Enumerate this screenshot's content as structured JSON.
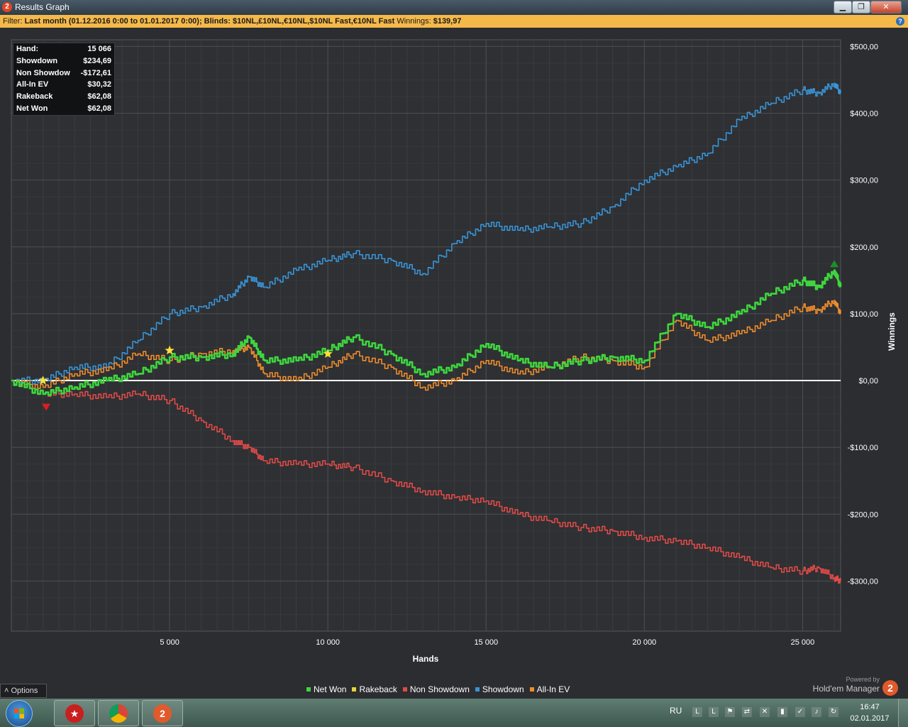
{
  "window": {
    "app_icon": "hm2-logo-icon",
    "title": "Results Graph",
    "controls": [
      "minimize-icon",
      "maximize-icon",
      "close-icon"
    ]
  },
  "filter": {
    "label": "Filter:",
    "text": "Last month (01.12.2016 0:00 to 01.01.2017 0:00); Blinds: $10NL,£10NL,€10NL,$10NL Fast,€10NL Fast",
    "winnings_label": "Winnings:",
    "winnings_value": "$139,97"
  },
  "stats": [
    {
      "label": "Hand:",
      "value": "15 066"
    },
    {
      "label": "Showdown",
      "value": "$234,69"
    },
    {
      "label": "Non Showdown",
      "value": "-$172,61"
    },
    {
      "label": "All-In EV",
      "value": "$30,32"
    },
    {
      "label": "Rakeback",
      "value": "$62,08"
    },
    {
      "label": "Net Won",
      "value": "$62,08"
    }
  ],
  "chart_data": {
    "type": "line",
    "xlabel": "Hands",
    "ylabel": "Winnings",
    "xlim": [
      0,
      26200
    ],
    "ylim": [
      -375,
      510
    ],
    "x_ticks": [
      5000,
      10000,
      15000,
      20000,
      25000
    ],
    "x_tick_labels": [
      "5 000",
      "10 000",
      "15 000",
      "20 000",
      "25 000"
    ],
    "y_ticks": [
      500,
      400,
      300,
      200,
      100,
      0,
      -100,
      -200,
      -300
    ],
    "y_tick_labels": [
      "$500,00",
      "$400,00",
      "$300,00",
      "$200,00",
      "$100,00",
      "$0,00",
      "-$100,00",
      "-$200,00",
      "-$300,00"
    ],
    "grid": true,
    "legend_position": "bottom",
    "x": [
      0,
      1000,
      2000,
      3000,
      4000,
      5000,
      6000,
      7000,
      7500,
      8000,
      9000,
      10000,
      10800,
      12000,
      13000,
      14000,
      15000,
      16000,
      17000,
      18000,
      19000,
      20000,
      21000,
      22000,
      23000,
      24000,
      25000,
      25500,
      26000,
      26200
    ],
    "series": [
      {
        "name": "Net Won",
        "color": "#3ed63e",
        "values": [
          0,
          -20,
          -10,
          0,
          10,
          35,
          35,
          40,
          65,
          30,
          30,
          45,
          65,
          40,
          10,
          20,
          55,
          30,
          20,
          30,
          35,
          30,
          100,
          80,
          100,
          130,
          150,
          140,
          165,
          140
        ]
      },
      {
        "name": "Rakeback",
        "color": "#e6d23c",
        "values": [
          0,
          -5,
          -5,
          -5,
          -5,
          -5,
          -5,
          -5,
          -5,
          -5,
          -5,
          -5,
          -5,
          -5,
          -5,
          -5,
          -5,
          -5,
          -5,
          -5,
          -5,
          -5,
          -5,
          -5,
          -5,
          -5,
          -5,
          -5,
          -5,
          -5
        ]
      },
      {
        "name": "Non Showdown",
        "color": "#e04a48",
        "values": [
          0,
          -20,
          -20,
          -25,
          -20,
          -30,
          -60,
          -90,
          -100,
          -120,
          -125,
          -125,
          -130,
          -150,
          -165,
          -175,
          -180,
          -200,
          -210,
          -220,
          -225,
          -235,
          -240,
          -250,
          -265,
          -280,
          -285,
          -280,
          -295,
          -300
        ]
      },
      {
        "name": "Showdown",
        "color": "#3a93d6",
        "values": [
          0,
          0,
          20,
          20,
          60,
          100,
          110,
          130,
          155,
          140,
          165,
          180,
          190,
          180,
          160,
          205,
          235,
          225,
          230,
          235,
          260,
          300,
          320,
          340,
          390,
          415,
          435,
          430,
          445,
          430
        ]
      },
      {
        "name": "All-In EV",
        "color": "#f08c2c",
        "values": [
          0,
          -10,
          10,
          15,
          40,
          30,
          40,
          45,
          50,
          10,
          0,
          20,
          40,
          20,
          -10,
          0,
          30,
          10,
          20,
          35,
          30,
          20,
          90,
          60,
          70,
          90,
          110,
          105,
          120,
          100
        ]
      }
    ],
    "markers": [
      {
        "symbol": "star",
        "x": 1000,
        "y": 0
      },
      {
        "symbol": "star",
        "x": 5000,
        "y": 45
      },
      {
        "symbol": "star",
        "x": 10000,
        "y": 40
      },
      {
        "symbol": "triangle-down",
        "x": 1100,
        "y": -40
      },
      {
        "symbol": "triangle-up",
        "x": 26000,
        "y": 175
      }
    ]
  },
  "legend": [
    {
      "name": "Net Won",
      "color": "#3ed63e"
    },
    {
      "name": "Rakeback",
      "color": "#e6d23c"
    },
    {
      "name": "Non Showdown",
      "color": "#e04a48"
    },
    {
      "name": "Showdown",
      "color": "#3a93d6"
    },
    {
      "name": "All-In EV",
      "color": "#f08c2c"
    }
  ],
  "footer": {
    "options_label": "Options",
    "options_icon": "chevron-up-icon",
    "powered_by": "Powered by",
    "product": "Hold'em Manager",
    "logo_text": "2"
  },
  "taskbar": {
    "apps": [
      "pokerstars-icon",
      "chrome-icon",
      "holdem-manager-icon"
    ],
    "language": "RU",
    "tray_icons": [
      "lav-icon",
      "lav-icon",
      "flag-icon",
      "network-icon",
      "shield-icon",
      "signal-icon",
      "check-icon",
      "volume-icon",
      "update-icon"
    ],
    "time": "16:47",
    "date": "02.01.2017"
  }
}
